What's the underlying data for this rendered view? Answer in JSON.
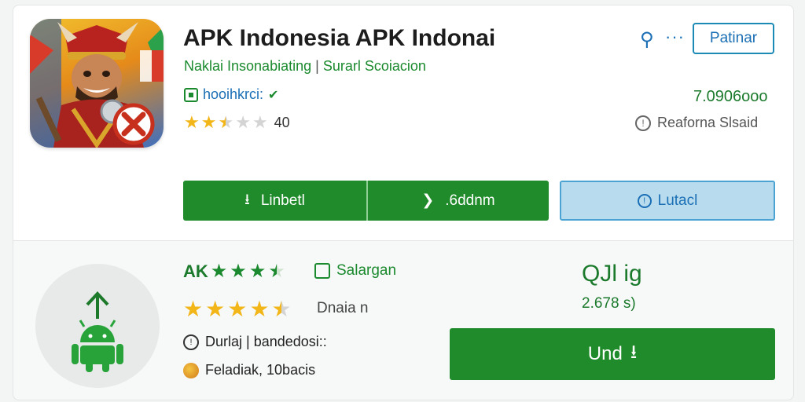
{
  "app": {
    "title": "APK Indonesia APK Indonai",
    "subtitle_left": "Naklai Insonabiating",
    "subtitle_sep": "|",
    "subtitle_right": "Surarl Scoiacion",
    "developer": "hooihkrci:",
    "rating_count": "40",
    "stars_rating": 2.5,
    "size": "7.0906ooo",
    "reported_label": "Reaforna Slsaid"
  },
  "toolbar": {
    "search_icon": "search-icon",
    "more_icon": "more-dots",
    "top_button_label": "Patinar"
  },
  "actions": {
    "primary_label": "Linbetl",
    "secondary_label": ".6ddnm",
    "outline_label": "Lutacl"
  },
  "related": {
    "title_prefix": "AK",
    "title_stars": 3.5,
    "tag_label": "Salargan",
    "stars_rating": 4.5,
    "stars_label": "Dnaia n",
    "info_label": "Durlaj | bandedosi::",
    "dev_label": "Feladiak, 10bacis",
    "name": "QJl ig",
    "size": "2.678 s)",
    "download_label": "Und"
  },
  "colors": {
    "brand_green": "#208b2a",
    "link_blue": "#1b6fb5",
    "star_gold": "#f2b619"
  }
}
